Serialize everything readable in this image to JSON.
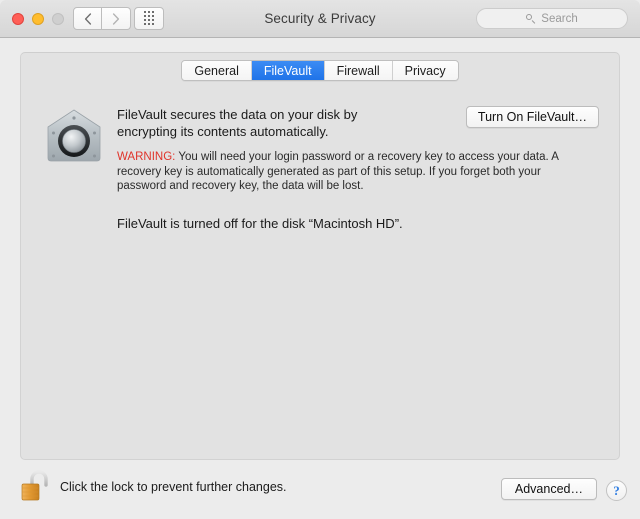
{
  "window": {
    "title": "Security & Privacy",
    "traffic_lights": [
      {
        "name": "close",
        "color": "#ff5f57"
      },
      {
        "name": "minimize",
        "color": "#ffbd2e"
      },
      {
        "name": "zoom",
        "color": "#cfcfcf"
      }
    ],
    "nav": {
      "back_label": "‹",
      "forward_label": "›"
    },
    "show_all_label": "show-all-grid"
  },
  "search": {
    "placeholder": "Search",
    "value": "",
    "icon": "search-icon"
  },
  "tabs": [
    {
      "label": "General",
      "active": false
    },
    {
      "label": "FileVault",
      "active": true
    },
    {
      "label": "Firewall",
      "active": false
    },
    {
      "label": "Privacy",
      "active": false
    }
  ],
  "main": {
    "icon": "filevault-vault-icon",
    "description": "FileVault secures the data on your disk by encrypting its contents automatically.",
    "warning_label": "WARNING:",
    "warning_text": " You will need your login password or a recovery key to access your data. A recovery key is automatically generated as part of this setup. If you forget both your password and recovery key, the data will be lost.",
    "status": "FileVault is turned off for the disk “Macintosh HD”.",
    "turn_on_button": "Turn On FileVault…"
  },
  "footer": {
    "lock_icon": "unlocked-padlock-icon",
    "lock_text": "Click the lock to prevent further changes.",
    "advanced_button": "Advanced…",
    "help_button": "?"
  },
  "colors": {
    "accent_blue": "#2f7de1",
    "tab_active": "#1f73e8",
    "warning_red": "#e0342b",
    "panel_bg": "#e2e2e2",
    "window_bg": "#ececec",
    "toolbar_bg": "#d6d6d6",
    "lock_gold": "#e8a33d"
  }
}
